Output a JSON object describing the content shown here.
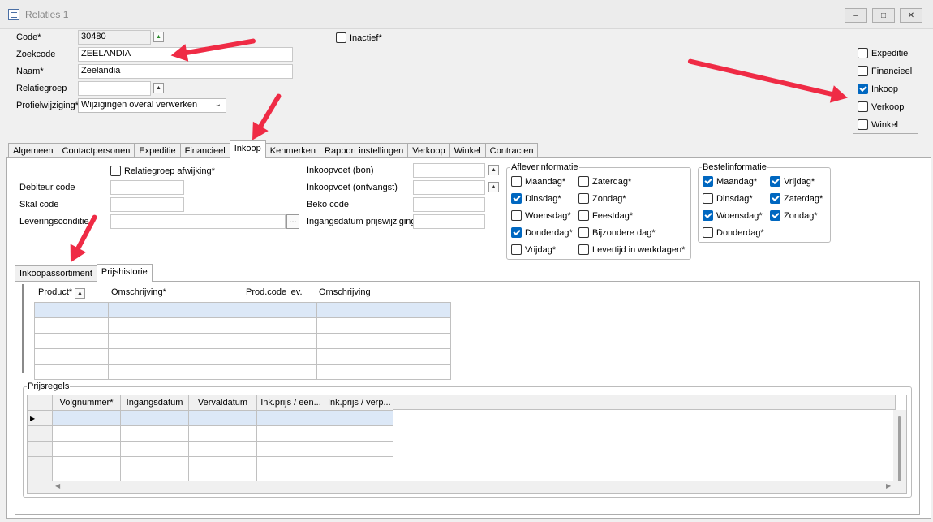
{
  "window": {
    "title": "Relaties 1",
    "min": "–",
    "max": "□",
    "close": "✕"
  },
  "header": {
    "code": {
      "label": "Code*",
      "value": "30480"
    },
    "zoekcode": {
      "label": "Zoekcode",
      "value": "ZEELANDIA"
    },
    "naam": {
      "label": "Naam*",
      "value": "Zeelandia"
    },
    "relatiegroep": {
      "label": "Relatiegroep",
      "value": ""
    },
    "profielwijziging": {
      "label": "Profielwijziging*",
      "value": "Wijzigingen overal verwerken"
    },
    "inactief": "Inactief*"
  },
  "roles": [
    {
      "label": "Expeditie",
      "checked": false
    },
    {
      "label": "Financieel",
      "checked": false
    },
    {
      "label": "Inkoop",
      "checked": true
    },
    {
      "label": "Verkoop",
      "checked": false
    },
    {
      "label": "Winkel",
      "checked": false
    }
  ],
  "tabs": [
    "Algemeen",
    "Contactpersonen",
    "Expeditie",
    "Financieel",
    "Inkoop",
    "Kenmerken",
    "Rapport instellingen",
    "Verkoop",
    "Winkel",
    "Contracten"
  ],
  "active_tab": "Inkoop",
  "inkoop": {
    "relatiegroep_afwijking": "Relatiegroep afwijking*",
    "debiteur_code": "Debiteur code",
    "skal_code": "Skal code",
    "leveringsconditie": "Leveringsconditie",
    "ellipsis": "...",
    "inkoopvoet_bon": "Inkoopvoet (bon)",
    "inkoopvoet_ontvangst": "Inkoopvoet (ontvangst)",
    "beko_code": "Beko code",
    "ingangsdatum": "Ingangsdatum prijswijziging"
  },
  "aflever": {
    "title": "Afleverinformatie",
    "items": [
      {
        "label": "Maandag*",
        "checked": false
      },
      {
        "label": "Zaterdag*",
        "checked": false
      },
      {
        "label": "Dinsdag*",
        "checked": true
      },
      {
        "label": "Zondag*",
        "checked": false
      },
      {
        "label": "Woensdag*",
        "checked": false
      },
      {
        "label": "Feestdag*",
        "checked": false
      },
      {
        "label": "Donderdag*",
        "checked": true
      },
      {
        "label": "Bijzondere dag*",
        "checked": false
      },
      {
        "label": "Vrijdag*",
        "checked": false
      },
      {
        "label": "Levertijd in werkdagen*",
        "checked": false
      }
    ]
  },
  "bestel": {
    "title": "Bestelinformatie",
    "items": [
      {
        "label": "Maandag*",
        "checked": true
      },
      {
        "label": "Vrijdag*",
        "checked": true
      },
      {
        "label": "Dinsdag*",
        "checked": false
      },
      {
        "label": "Zaterdag*",
        "checked": true
      },
      {
        "label": "Woensdag*",
        "checked": true
      },
      {
        "label": "Zondag*",
        "checked": true
      },
      {
        "label": "Donderdag*",
        "checked": false
      }
    ]
  },
  "subtabs": [
    "Inkoopassortiment",
    "Prijshistorie"
  ],
  "active_subtab": "Prijshistorie",
  "product_grid": {
    "headers": [
      "Product*",
      "Omschrijving*",
      "Prod.code lev.",
      "Omschrijving"
    ]
  },
  "prijsregels": {
    "title": "Prijsregels",
    "headers": [
      "Volgnummer*",
      "Ingangsdatum",
      "Vervaldatum",
      "Ink.prijs / een...",
      "Ink.prijs / verp..."
    ]
  }
}
